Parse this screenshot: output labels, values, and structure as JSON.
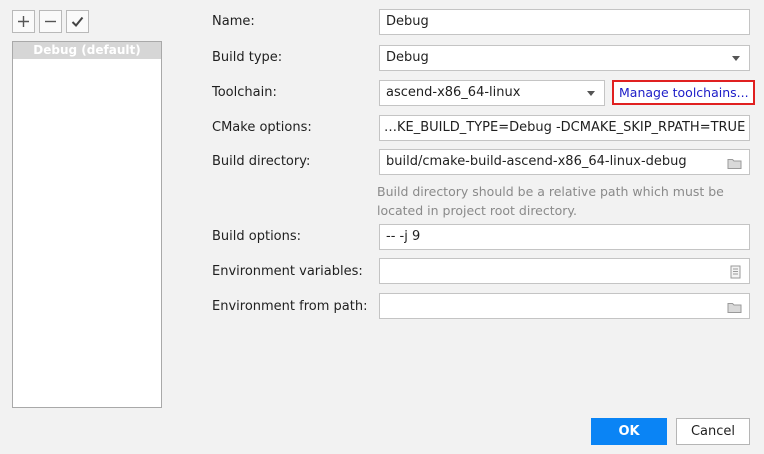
{
  "toolbar": {
    "add_icon": "plus-icon",
    "remove_icon": "minus-icon",
    "apply_icon": "checkmark-icon"
  },
  "profiles": [
    {
      "label": "Debug (default)"
    }
  ],
  "form": {
    "name": {
      "label": "Name:",
      "value": "Debug"
    },
    "build_type": {
      "label": "Build type:",
      "value": "Debug"
    },
    "toolchain": {
      "label": "Toolchain:",
      "value": "ascend-x86_64-linux",
      "manage_link": "Manage toolchains..."
    },
    "cmake_options": {
      "label": "CMake options:",
      "value": "…KE_BUILD_TYPE=Debug -DCMAKE_SKIP_RPATH=TRUE"
    },
    "build_directory": {
      "label": "Build directory:",
      "value": "build/cmake-build-ascend-x86_64-linux-debug",
      "hint": "Build directory should be a relative path which must be located in project root directory."
    },
    "build_options": {
      "label": "Build options:",
      "value": "-- -j 9"
    },
    "env_vars": {
      "label": "Environment variables:",
      "value": ""
    },
    "env_from_path": {
      "label": "Environment from path:",
      "value": ""
    }
  },
  "buttons": {
    "ok": "OK",
    "cancel": "Cancel"
  },
  "colors": {
    "accent": "#0a84f5",
    "highlight_border": "#e02020",
    "link": "#1c1cc8"
  }
}
